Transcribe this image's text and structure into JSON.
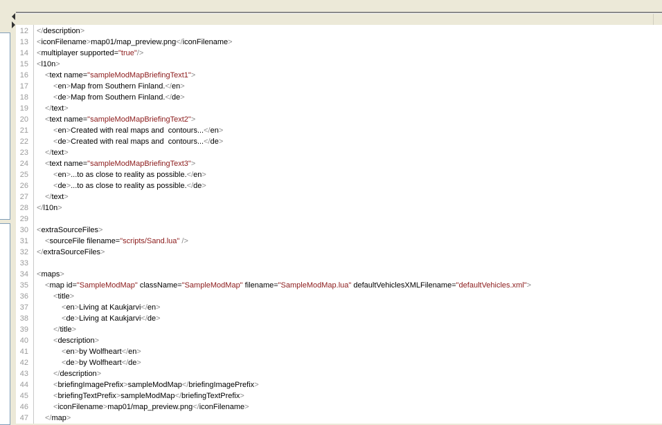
{
  "editor": {
    "lines": [
      {
        "num": "12",
        "indent": 0,
        "tokens": [
          {
            "k": "t",
            "s": "</"
          },
          {
            "k": "n",
            "s": "description"
          },
          {
            "k": "t",
            "s": ">"
          }
        ]
      },
      {
        "num": "13",
        "indent": 0,
        "tokens": [
          {
            "k": "t",
            "s": "<"
          },
          {
            "k": "n",
            "s": "iconFilename"
          },
          {
            "k": "t",
            "s": ">"
          },
          {
            "k": "x",
            "s": "map01/map_preview.png"
          },
          {
            "k": "t",
            "s": "</"
          },
          {
            "k": "n",
            "s": "iconFilename"
          },
          {
            "k": "t",
            "s": ">"
          }
        ]
      },
      {
        "num": "14",
        "indent": 0,
        "tokens": [
          {
            "k": "t",
            "s": "<"
          },
          {
            "k": "n",
            "s": "multiplayer supported="
          },
          {
            "k": "v",
            "s": "\"true\""
          },
          {
            "k": "t",
            "s": "/>"
          }
        ]
      },
      {
        "num": "15",
        "indent": 0,
        "tokens": [
          {
            "k": "t",
            "s": "<"
          },
          {
            "k": "n",
            "s": "l10n"
          },
          {
            "k": "t",
            "s": ">"
          }
        ]
      },
      {
        "num": "16",
        "indent": 1,
        "tokens": [
          {
            "k": "t",
            "s": "<"
          },
          {
            "k": "n",
            "s": "text name="
          },
          {
            "k": "v",
            "s": "\"sampleModMapBriefingText1\""
          },
          {
            "k": "t",
            "s": ">"
          }
        ]
      },
      {
        "num": "17",
        "indent": 2,
        "tokens": [
          {
            "k": "t",
            "s": "<"
          },
          {
            "k": "n",
            "s": "en"
          },
          {
            "k": "t",
            "s": ">"
          },
          {
            "k": "x",
            "s": "Map from Southern Finland."
          },
          {
            "k": "t",
            "s": "</"
          },
          {
            "k": "n",
            "s": "en"
          },
          {
            "k": "t",
            "s": ">"
          }
        ]
      },
      {
        "num": "18",
        "indent": 2,
        "tokens": [
          {
            "k": "t",
            "s": "<"
          },
          {
            "k": "n",
            "s": "de"
          },
          {
            "k": "t",
            "s": ">"
          },
          {
            "k": "x",
            "s": "Map from Southern Finland."
          },
          {
            "k": "t",
            "s": "</"
          },
          {
            "k": "n",
            "s": "de"
          },
          {
            "k": "t",
            "s": ">"
          }
        ]
      },
      {
        "num": "19",
        "indent": 1,
        "tokens": [
          {
            "k": "t",
            "s": "</"
          },
          {
            "k": "n",
            "s": "text"
          },
          {
            "k": "t",
            "s": ">"
          }
        ]
      },
      {
        "num": "20",
        "indent": 1,
        "tokens": [
          {
            "k": "t",
            "s": "<"
          },
          {
            "k": "n",
            "s": "text name="
          },
          {
            "k": "v",
            "s": "\"sampleModMapBriefingText2\""
          },
          {
            "k": "t",
            "s": ">"
          }
        ]
      },
      {
        "num": "21",
        "indent": 2,
        "tokens": [
          {
            "k": "t",
            "s": "<"
          },
          {
            "k": "n",
            "s": "en"
          },
          {
            "k": "t",
            "s": ">"
          },
          {
            "k": "x",
            "s": "Created with real maps and  contours..."
          },
          {
            "k": "t",
            "s": "</"
          },
          {
            "k": "n",
            "s": "en"
          },
          {
            "k": "t",
            "s": ">"
          }
        ]
      },
      {
        "num": "22",
        "indent": 2,
        "tokens": [
          {
            "k": "t",
            "s": "<"
          },
          {
            "k": "n",
            "s": "de"
          },
          {
            "k": "t",
            "s": ">"
          },
          {
            "k": "x",
            "s": "Created with real maps and  contours..."
          },
          {
            "k": "t",
            "s": "</"
          },
          {
            "k": "n",
            "s": "de"
          },
          {
            "k": "t",
            "s": ">"
          }
        ]
      },
      {
        "num": "23",
        "indent": 1,
        "tokens": [
          {
            "k": "t",
            "s": "</"
          },
          {
            "k": "n",
            "s": "text"
          },
          {
            "k": "t",
            "s": ">"
          }
        ]
      },
      {
        "num": "24",
        "indent": 1,
        "tokens": [
          {
            "k": "t",
            "s": "<"
          },
          {
            "k": "n",
            "s": "text name="
          },
          {
            "k": "v",
            "s": "\"sampleModMapBriefingText3\""
          },
          {
            "k": "t",
            "s": ">"
          }
        ]
      },
      {
        "num": "25",
        "indent": 2,
        "tokens": [
          {
            "k": "t",
            "s": "<"
          },
          {
            "k": "n",
            "s": "en"
          },
          {
            "k": "t",
            "s": ">"
          },
          {
            "k": "x",
            "s": "...to as close to reality as possible."
          },
          {
            "k": "t",
            "s": "</"
          },
          {
            "k": "n",
            "s": "en"
          },
          {
            "k": "t",
            "s": ">"
          }
        ]
      },
      {
        "num": "26",
        "indent": 2,
        "tokens": [
          {
            "k": "t",
            "s": "<"
          },
          {
            "k": "n",
            "s": "de"
          },
          {
            "k": "t",
            "s": ">"
          },
          {
            "k": "x",
            "s": "...to as close to reality as possible."
          },
          {
            "k": "t",
            "s": "</"
          },
          {
            "k": "n",
            "s": "de"
          },
          {
            "k": "t",
            "s": ">"
          }
        ]
      },
      {
        "num": "27",
        "indent": 1,
        "tokens": [
          {
            "k": "t",
            "s": "</"
          },
          {
            "k": "n",
            "s": "text"
          },
          {
            "k": "t",
            "s": ">"
          }
        ]
      },
      {
        "num": "28",
        "indent": 0,
        "tokens": [
          {
            "k": "t",
            "s": "</"
          },
          {
            "k": "n",
            "s": "l10n"
          },
          {
            "k": "t",
            "s": ">"
          }
        ]
      },
      {
        "num": "29",
        "indent": 0,
        "tokens": []
      },
      {
        "num": "30",
        "indent": 0,
        "tokens": [
          {
            "k": "t",
            "s": "<"
          },
          {
            "k": "n",
            "s": "extraSourceFiles"
          },
          {
            "k": "t",
            "s": ">"
          }
        ]
      },
      {
        "num": "31",
        "indent": 1,
        "tokens": [
          {
            "k": "t",
            "s": "<"
          },
          {
            "k": "n",
            "s": "sourceFile filename="
          },
          {
            "k": "v",
            "s": "\"scripts/Sand.lua\""
          },
          {
            "k": "t",
            "s": " />"
          }
        ]
      },
      {
        "num": "32",
        "indent": 0,
        "tokens": [
          {
            "k": "t",
            "s": "</"
          },
          {
            "k": "n",
            "s": "extraSourceFiles"
          },
          {
            "k": "t",
            "s": ">"
          }
        ]
      },
      {
        "num": "33",
        "indent": 0,
        "tokens": []
      },
      {
        "num": "34",
        "indent": 0,
        "tokens": [
          {
            "k": "t",
            "s": "<"
          },
          {
            "k": "n",
            "s": "maps"
          },
          {
            "k": "t",
            "s": ">"
          }
        ]
      },
      {
        "num": "35",
        "indent": 1,
        "tokens": [
          {
            "k": "t",
            "s": "<"
          },
          {
            "k": "n",
            "s": "map id="
          },
          {
            "k": "v",
            "s": "\"SampleModMap\""
          },
          {
            "k": "n",
            "s": " className="
          },
          {
            "k": "v",
            "s": "\"SampleModMap\""
          },
          {
            "k": "n",
            "s": " filename="
          },
          {
            "k": "v",
            "s": "\"SampleModMap.lua\""
          },
          {
            "k": "n",
            "s": " defaultVehiclesXMLFilename="
          },
          {
            "k": "v",
            "s": "\"defaultVehicles.xml\""
          },
          {
            "k": "t",
            "s": ">"
          }
        ]
      },
      {
        "num": "36",
        "indent": 2,
        "tokens": [
          {
            "k": "t",
            "s": "<"
          },
          {
            "k": "n",
            "s": "title"
          },
          {
            "k": "t",
            "s": ">"
          }
        ]
      },
      {
        "num": "37",
        "indent": 3,
        "tokens": [
          {
            "k": "t",
            "s": "<"
          },
          {
            "k": "n",
            "s": "en"
          },
          {
            "k": "t",
            "s": ">"
          },
          {
            "k": "x",
            "s": "Living at Kaukjarvi"
          },
          {
            "k": "t",
            "s": "</"
          },
          {
            "k": "n",
            "s": "en"
          },
          {
            "k": "t",
            "s": ">"
          }
        ]
      },
      {
        "num": "38",
        "indent": 3,
        "tokens": [
          {
            "k": "t",
            "s": "<"
          },
          {
            "k": "n",
            "s": "de"
          },
          {
            "k": "t",
            "s": ">"
          },
          {
            "k": "x",
            "s": "Living at Kaukjarvi"
          },
          {
            "k": "t",
            "s": "</"
          },
          {
            "k": "n",
            "s": "de"
          },
          {
            "k": "t",
            "s": ">"
          }
        ]
      },
      {
        "num": "39",
        "indent": 2,
        "tokens": [
          {
            "k": "t",
            "s": "</"
          },
          {
            "k": "n",
            "s": "title"
          },
          {
            "k": "t",
            "s": ">"
          }
        ]
      },
      {
        "num": "40",
        "indent": 2,
        "tokens": [
          {
            "k": "t",
            "s": "<"
          },
          {
            "k": "n",
            "s": "description"
          },
          {
            "k": "t",
            "s": ">"
          }
        ]
      },
      {
        "num": "41",
        "indent": 3,
        "tokens": [
          {
            "k": "t",
            "s": "<"
          },
          {
            "k": "n",
            "s": "en"
          },
          {
            "k": "t",
            "s": ">"
          },
          {
            "k": "x",
            "s": "by Wolfheart"
          },
          {
            "k": "t",
            "s": "</"
          },
          {
            "k": "n",
            "s": "en"
          },
          {
            "k": "t",
            "s": ">"
          }
        ]
      },
      {
        "num": "42",
        "indent": 3,
        "tokens": [
          {
            "k": "t",
            "s": "<"
          },
          {
            "k": "n",
            "s": "de"
          },
          {
            "k": "t",
            "s": ">"
          },
          {
            "k": "x",
            "s": "by Wolfheart"
          },
          {
            "k": "t",
            "s": "</"
          },
          {
            "k": "n",
            "s": "de"
          },
          {
            "k": "t",
            "s": ">"
          }
        ]
      },
      {
        "num": "43",
        "indent": 2,
        "tokens": [
          {
            "k": "t",
            "s": "</"
          },
          {
            "k": "n",
            "s": "description"
          },
          {
            "k": "t",
            "s": ">"
          }
        ]
      },
      {
        "num": "44",
        "indent": 2,
        "tokens": [
          {
            "k": "t",
            "s": "<"
          },
          {
            "k": "n",
            "s": "briefingImagePrefix"
          },
          {
            "k": "t",
            "s": ">"
          },
          {
            "k": "x",
            "s": "sampleModMap"
          },
          {
            "k": "t",
            "s": "</"
          },
          {
            "k": "n",
            "s": "briefingImagePrefix"
          },
          {
            "k": "t",
            "s": ">"
          }
        ]
      },
      {
        "num": "45",
        "indent": 2,
        "tokens": [
          {
            "k": "t",
            "s": "<"
          },
          {
            "k": "n",
            "s": "briefingTextPrefix"
          },
          {
            "k": "t",
            "s": ">"
          },
          {
            "k": "x",
            "s": "sampleModMap"
          },
          {
            "k": "t",
            "s": "</"
          },
          {
            "k": "n",
            "s": "briefingTextPrefix"
          },
          {
            "k": "t",
            "s": ">"
          }
        ]
      },
      {
        "num": "46",
        "indent": 2,
        "tokens": [
          {
            "k": "t",
            "s": "<"
          },
          {
            "k": "n",
            "s": "iconFilename"
          },
          {
            "k": "t",
            "s": ">"
          },
          {
            "k": "x",
            "s": "map01/map_preview.png"
          },
          {
            "k": "t",
            "s": "</"
          },
          {
            "k": "n",
            "s": "iconFilename"
          },
          {
            "k": "t",
            "s": ">"
          }
        ]
      },
      {
        "num": "47",
        "indent": 1,
        "tokens": [
          {
            "k": "t",
            "s": "</"
          },
          {
            "k": "n",
            "s": "map"
          },
          {
            "k": "t",
            "s": ">"
          }
        ]
      }
    ]
  },
  "colors": {
    "tag_punct": "#8a8a8a",
    "tag_name": "#000000",
    "attr_value": "#8b1a1a",
    "line_number": "#9a9a9a"
  }
}
